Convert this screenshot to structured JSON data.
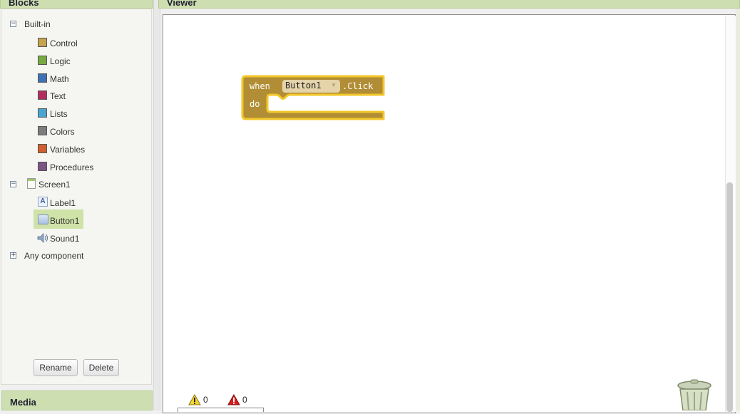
{
  "blocks_panel": {
    "title": "Blocks",
    "builtin": {
      "label": "Built-in",
      "items": [
        {
          "label": "Control",
          "color": "#c7a34f"
        },
        {
          "label": "Logic",
          "color": "#77ab41"
        },
        {
          "label": "Math",
          "color": "#3f71b5"
        },
        {
          "label": "Text",
          "color": "#b32d5e"
        },
        {
          "label": "Lists",
          "color": "#49a6d4"
        },
        {
          "label": "Colors",
          "color": "#7d7d7d"
        },
        {
          "label": "Variables",
          "color": "#d05f2d"
        },
        {
          "label": "Procedures",
          "color": "#7c5385"
        }
      ]
    },
    "screen": {
      "label": "Screen1",
      "components": [
        {
          "label": "Label1",
          "icon": "label-component-icon"
        },
        {
          "label": "Button1",
          "icon": "button-component-icon",
          "selected": true
        },
        {
          "label": "Sound1",
          "icon": "sound-component-icon"
        }
      ]
    },
    "any_component": {
      "label": "Any component"
    },
    "rename_label": "Rename",
    "delete_label": "Delete"
  },
  "media_panel": {
    "title": "Media"
  },
  "viewer": {
    "title": "Viewer",
    "event_block": {
      "when_label": "when",
      "component": "Button1",
      "event": ".Click",
      "do_label": "do",
      "color": "#b18e35",
      "highlight": "#f2c72a"
    },
    "warnings_count": "0",
    "errors_count": "0"
  }
}
